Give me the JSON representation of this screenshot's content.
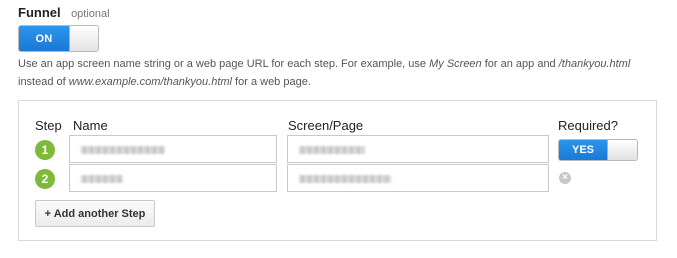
{
  "funnel": {
    "title": "Funnel",
    "optional_label": "optional",
    "toggle_label": "ON"
  },
  "help": {
    "part1": "Use an app screen name string or a web page URL for each step. For example, use ",
    "example_app": "My Screen",
    "part2": " for an app and ",
    "example_url": "/thankyou.html",
    "part3": " instead of ",
    "example_full_url": "www.example.com/thankyou.html",
    "part4": " for a web page."
  },
  "steps": {
    "columns": {
      "step": "Step",
      "name": "Name",
      "screen_page": "Screen/Page",
      "required": "Required?"
    },
    "rows": [
      {
        "number": "1"
      },
      {
        "number": "2"
      }
    ],
    "required_toggle_label": "YES",
    "add_button_label": "+ Add another Step"
  },
  "colors": {
    "accent_blue": "#1a79d6",
    "step_green": "#7dba3b"
  }
}
